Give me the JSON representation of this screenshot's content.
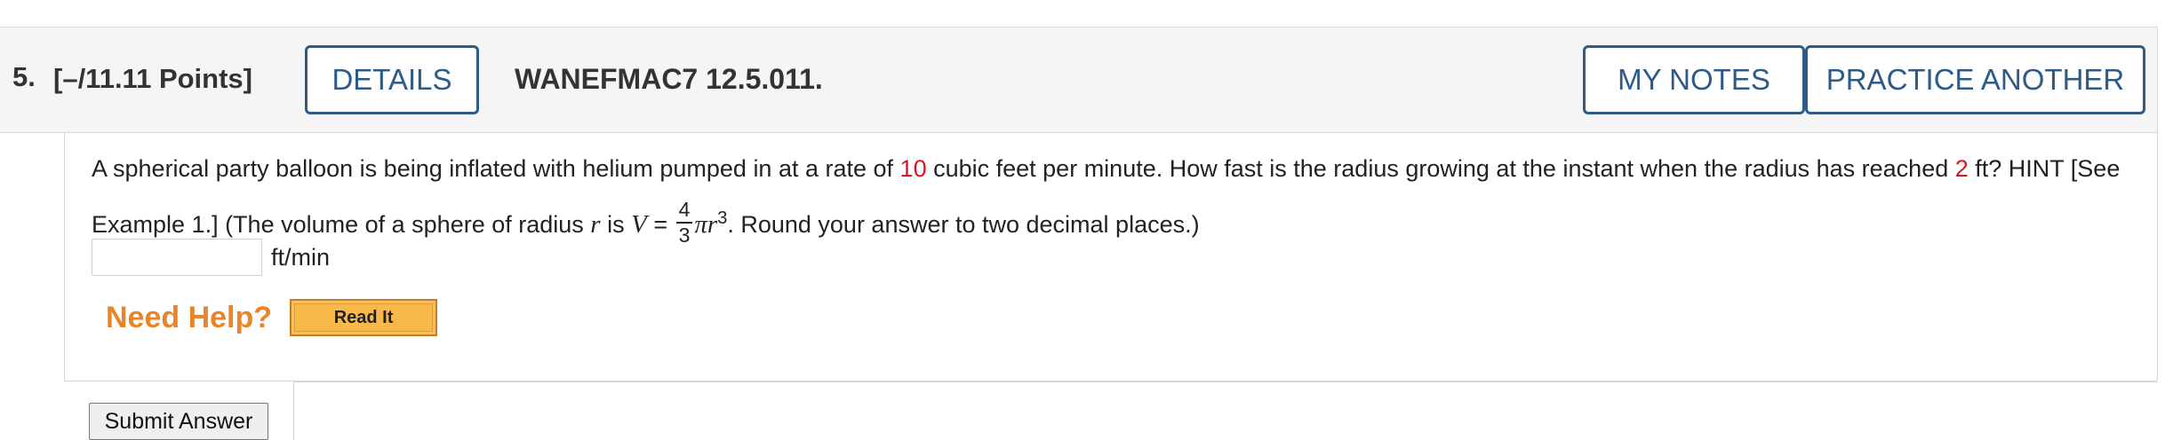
{
  "header": {
    "question_number": "5.",
    "points": "[–/11.11 Points]",
    "details_label": "DETAILS",
    "question_code": "WANEFMAC7 12.5.011.",
    "my_notes_label": "MY NOTES",
    "practice_another_label": "PRACTICE ANOTHER"
  },
  "problem": {
    "part1": "A spherical party balloon is being inflated with helium pumped in at a rate of ",
    "rate_value": "10",
    "part2": " cubic feet per minute. How fast is the radius growing at the instant when the radius has reached ",
    "radius_value": "2",
    "part3": " ft? HINT [See Example 1.] (The volume of a sphere of radius ",
    "var_r": "r",
    "part4": " is ",
    "var_V": "V",
    "equals": " = ",
    "frac_num": "4",
    "frac_den": "3",
    "pi_r": "πr",
    "exponent": "3",
    "part5": ". Round your answer to two decimal places.)"
  },
  "answer": {
    "value": "",
    "unit": "ft/min"
  },
  "help": {
    "need_help_label": "Need Help?",
    "read_it_label": "Read It"
  },
  "submit": {
    "label": "Submit Answer"
  },
  "colors": {
    "accent": "#2e5a86",
    "highlight_red": "#e0121e",
    "need_help_orange": "#e8852a",
    "read_it_fill": "#f8b94a"
  }
}
